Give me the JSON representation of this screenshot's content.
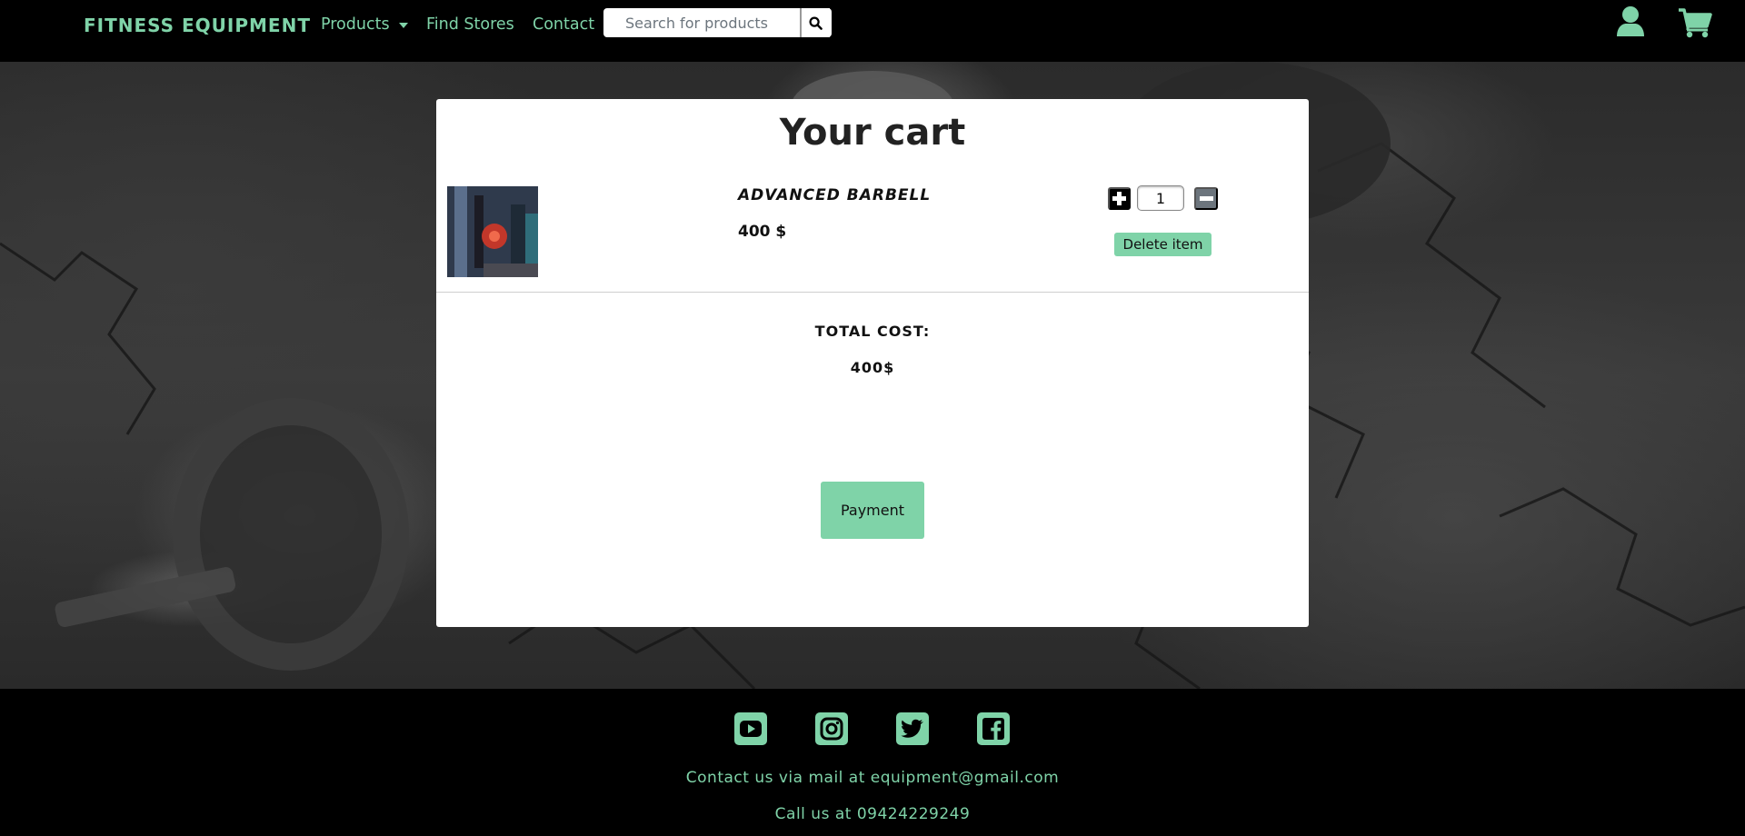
{
  "navbar": {
    "brand": "FITNESS EQUIPMENT",
    "links": {
      "products": "Products",
      "find_stores": "Find Stores",
      "contact": "Contact"
    },
    "search": {
      "placeholder": "Search for products",
      "value": ""
    },
    "icons": [
      "user-icon",
      "cart-icon",
      "search-icon"
    ]
  },
  "cart": {
    "title": "Your cart",
    "items": [
      {
        "name": "ADVANCED BARBELL",
        "price": "400 $",
        "quantity": "1",
        "delete_label": "Delete item"
      }
    ],
    "total_label": "TOTAL COST:",
    "total_value": "400$",
    "payment_label": "Payment"
  },
  "footer": {
    "social": [
      "youtube-icon",
      "instagram-icon",
      "twitter-icon",
      "facebook-icon"
    ],
    "mail_text": "Contact us via mail at equipment@gmail.com",
    "phone_text": "Call us at 09424229249"
  },
  "colors": {
    "accent": "#7fd3a8",
    "navbar_bg": "#000000",
    "card_bg": "#ffffff",
    "minus_button": "#6c757d"
  }
}
